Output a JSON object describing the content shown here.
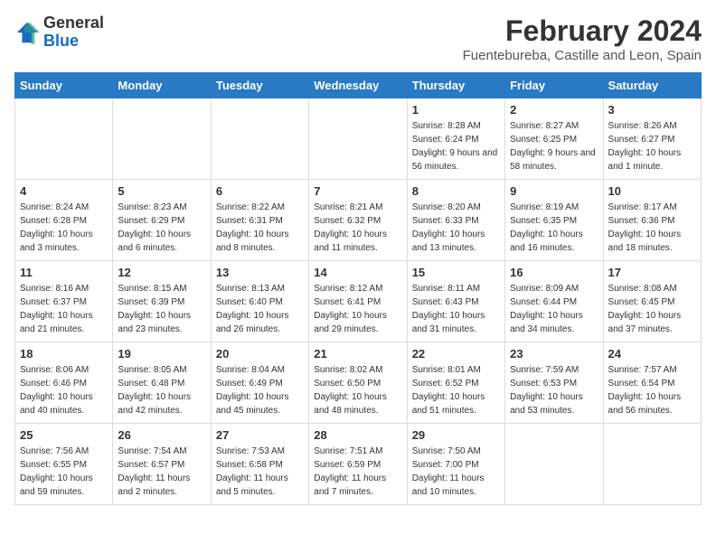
{
  "header": {
    "logo_general": "General",
    "logo_blue": "Blue",
    "title": "February 2024",
    "subtitle": "Fuentebureba, Castille and Leon, Spain"
  },
  "weekdays": [
    "Sunday",
    "Monday",
    "Tuesday",
    "Wednesday",
    "Thursday",
    "Friday",
    "Saturday"
  ],
  "weeks": [
    [
      {
        "day": "",
        "info": ""
      },
      {
        "day": "",
        "info": ""
      },
      {
        "day": "",
        "info": ""
      },
      {
        "day": "",
        "info": ""
      },
      {
        "day": "1",
        "info": "Sunrise: 8:28 AM\nSunset: 6:24 PM\nDaylight: 9 hours\nand 56 minutes."
      },
      {
        "day": "2",
        "info": "Sunrise: 8:27 AM\nSunset: 6:25 PM\nDaylight: 9 hours\nand 58 minutes."
      },
      {
        "day": "3",
        "info": "Sunrise: 8:26 AM\nSunset: 6:27 PM\nDaylight: 10 hours\nand 1 minute."
      }
    ],
    [
      {
        "day": "4",
        "info": "Sunrise: 8:24 AM\nSunset: 6:28 PM\nDaylight: 10 hours\nand 3 minutes."
      },
      {
        "day": "5",
        "info": "Sunrise: 8:23 AM\nSunset: 6:29 PM\nDaylight: 10 hours\nand 6 minutes."
      },
      {
        "day": "6",
        "info": "Sunrise: 8:22 AM\nSunset: 6:31 PM\nDaylight: 10 hours\nand 8 minutes."
      },
      {
        "day": "7",
        "info": "Sunrise: 8:21 AM\nSunset: 6:32 PM\nDaylight: 10 hours\nand 11 minutes."
      },
      {
        "day": "8",
        "info": "Sunrise: 8:20 AM\nSunset: 6:33 PM\nDaylight: 10 hours\nand 13 minutes."
      },
      {
        "day": "9",
        "info": "Sunrise: 8:19 AM\nSunset: 6:35 PM\nDaylight: 10 hours\nand 16 minutes."
      },
      {
        "day": "10",
        "info": "Sunrise: 8:17 AM\nSunset: 6:36 PM\nDaylight: 10 hours\nand 18 minutes."
      }
    ],
    [
      {
        "day": "11",
        "info": "Sunrise: 8:16 AM\nSunset: 6:37 PM\nDaylight: 10 hours\nand 21 minutes."
      },
      {
        "day": "12",
        "info": "Sunrise: 8:15 AM\nSunset: 6:39 PM\nDaylight: 10 hours\nand 23 minutes."
      },
      {
        "day": "13",
        "info": "Sunrise: 8:13 AM\nSunset: 6:40 PM\nDaylight: 10 hours\nand 26 minutes."
      },
      {
        "day": "14",
        "info": "Sunrise: 8:12 AM\nSunset: 6:41 PM\nDaylight: 10 hours\nand 29 minutes."
      },
      {
        "day": "15",
        "info": "Sunrise: 8:11 AM\nSunset: 6:43 PM\nDaylight: 10 hours\nand 31 minutes."
      },
      {
        "day": "16",
        "info": "Sunrise: 8:09 AM\nSunset: 6:44 PM\nDaylight: 10 hours\nand 34 minutes."
      },
      {
        "day": "17",
        "info": "Sunrise: 8:08 AM\nSunset: 6:45 PM\nDaylight: 10 hours\nand 37 minutes."
      }
    ],
    [
      {
        "day": "18",
        "info": "Sunrise: 8:06 AM\nSunset: 6:46 PM\nDaylight: 10 hours\nand 40 minutes."
      },
      {
        "day": "19",
        "info": "Sunrise: 8:05 AM\nSunset: 6:48 PM\nDaylight: 10 hours\nand 42 minutes."
      },
      {
        "day": "20",
        "info": "Sunrise: 8:04 AM\nSunset: 6:49 PM\nDaylight: 10 hours\nand 45 minutes."
      },
      {
        "day": "21",
        "info": "Sunrise: 8:02 AM\nSunset: 6:50 PM\nDaylight: 10 hours\nand 48 minutes."
      },
      {
        "day": "22",
        "info": "Sunrise: 8:01 AM\nSunset: 6:52 PM\nDaylight: 10 hours\nand 51 minutes."
      },
      {
        "day": "23",
        "info": "Sunrise: 7:59 AM\nSunset: 6:53 PM\nDaylight: 10 hours\nand 53 minutes."
      },
      {
        "day": "24",
        "info": "Sunrise: 7:57 AM\nSunset: 6:54 PM\nDaylight: 10 hours\nand 56 minutes."
      }
    ],
    [
      {
        "day": "25",
        "info": "Sunrise: 7:56 AM\nSunset: 6:55 PM\nDaylight: 10 hours\nand 59 minutes."
      },
      {
        "day": "26",
        "info": "Sunrise: 7:54 AM\nSunset: 6:57 PM\nDaylight: 11 hours\nand 2 minutes."
      },
      {
        "day": "27",
        "info": "Sunrise: 7:53 AM\nSunset: 6:58 PM\nDaylight: 11 hours\nand 5 minutes."
      },
      {
        "day": "28",
        "info": "Sunrise: 7:51 AM\nSunset: 6:59 PM\nDaylight: 11 hours\nand 7 minutes."
      },
      {
        "day": "29",
        "info": "Sunrise: 7:50 AM\nSunset: 7:00 PM\nDaylight: 11 hours\nand 10 minutes."
      },
      {
        "day": "",
        "info": ""
      },
      {
        "day": "",
        "info": ""
      }
    ]
  ]
}
